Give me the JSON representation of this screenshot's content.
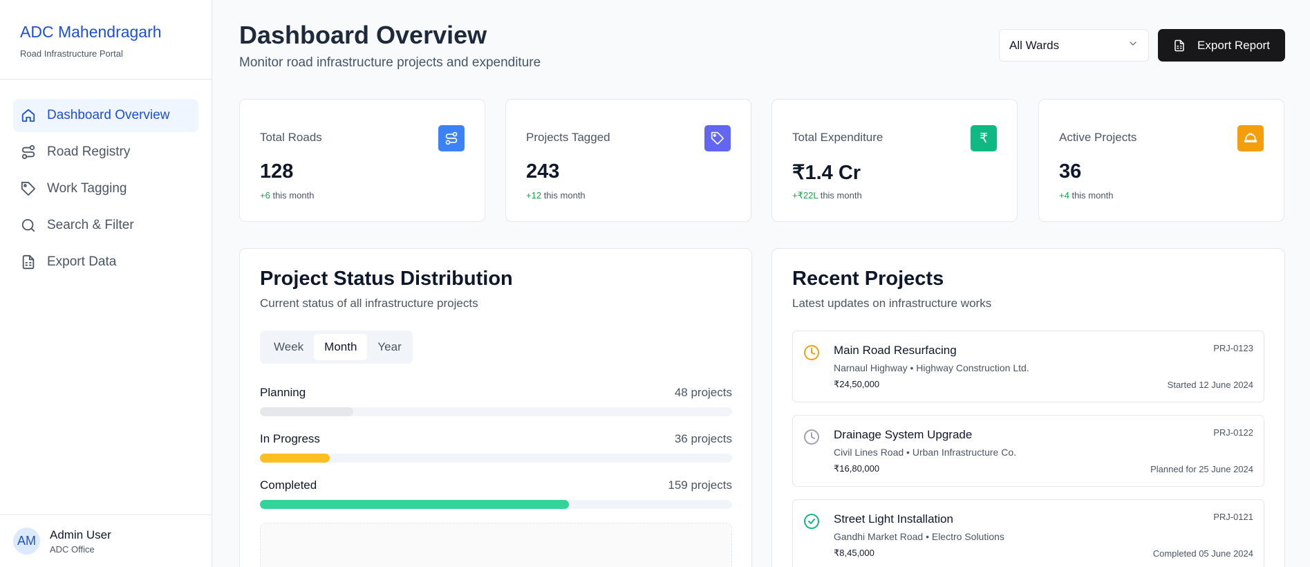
{
  "sidebar": {
    "brand_title": "ADC Mahendragarh",
    "brand_subtitle": "Road Infrastructure Portal",
    "items": [
      {
        "label": "Dashboard Overview",
        "icon": "home-icon",
        "active": true
      },
      {
        "label": "Road Registry",
        "icon": "route-icon",
        "active": false
      },
      {
        "label": "Work Tagging",
        "icon": "tag-icon",
        "active": false
      },
      {
        "label": "Search & Filter",
        "icon": "search-icon",
        "active": false
      },
      {
        "label": "Export Data",
        "icon": "file-spreadsheet-icon",
        "active": false
      }
    ],
    "user": {
      "initials": "AM",
      "name": "Admin User",
      "role": "ADC Office"
    }
  },
  "header": {
    "title": "Dashboard Overview",
    "subtitle": "Monitor road infrastructure projects and expenditure",
    "ward_select": "All Wards",
    "export_label": "Export Report"
  },
  "stats": [
    {
      "label": "Total Roads",
      "value": "128",
      "change": "+6",
      "suffix": "this month",
      "icon": "route-icon",
      "color": "#3b82f6"
    },
    {
      "label": "Projects Tagged",
      "value": "243",
      "change": "+12",
      "suffix": "this month",
      "icon": "tag-icon",
      "color": "#6366f1"
    },
    {
      "label": "Total Expenditure",
      "value": "₹1.4 Cr",
      "change": "+₹22L",
      "suffix": "this month",
      "icon": "rupee-icon",
      "color": "#10b981"
    },
    {
      "label": "Active Projects",
      "value": "36",
      "change": "+4",
      "suffix": "this month",
      "icon": "hard-hat-icon",
      "color": "#f59e0b"
    }
  ],
  "status_panel": {
    "title": "Project Status Distribution",
    "subtitle": "Current status of all infrastructure projects",
    "tabs": [
      "Week",
      "Month",
      "Year"
    ],
    "active_tab": "Month",
    "statuses": [
      {
        "name": "Planning",
        "count": "48 projects",
        "fraction": 0.198,
        "color": "#e5e7eb"
      },
      {
        "name": "In Progress",
        "count": "36 projects",
        "fraction": 0.148,
        "color": "#fbbf24"
      },
      {
        "name": "Completed",
        "count": "159 projects",
        "fraction": 0.654,
        "color": "#34d399"
      }
    ]
  },
  "recent_panel": {
    "title": "Recent Projects",
    "subtitle": "Latest updates on infrastructure works",
    "projects": [
      {
        "name": "Main Road Resurfacing",
        "meta": "Narnaul Highway • Highway Construction Ltd.",
        "amount": "₹24,50,000",
        "id": "PRJ-0123",
        "date": "Started 12 June 2024",
        "icon": "clock-icon",
        "icon_color": "#f59e0b"
      },
      {
        "name": "Drainage System Upgrade",
        "meta": "Civil Lines Road • Urban Infrastructure Co.",
        "amount": "₹16,80,000",
        "id": "PRJ-0122",
        "date": "Planned for 25 June 2024",
        "icon": "clock-icon",
        "icon_color": "#9ca3af"
      },
      {
        "name": "Street Light Installation",
        "meta": "Gandhi Market Road • Electro Solutions",
        "amount": "₹8,45,000",
        "id": "PRJ-0121",
        "date": "Completed 05 June 2024",
        "icon": "check-circle-icon",
        "icon_color": "#10b981"
      }
    ]
  }
}
